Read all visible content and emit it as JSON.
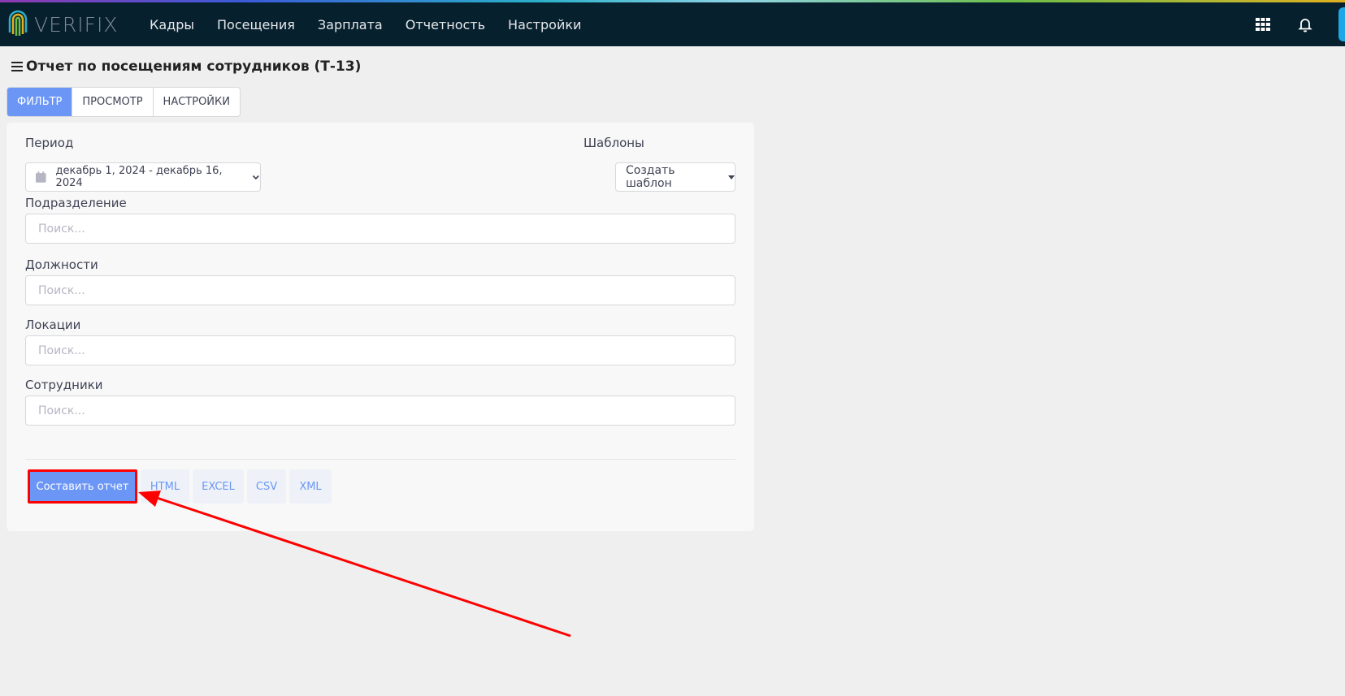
{
  "app": {
    "logo_text": "VERIFIX"
  },
  "nav": {
    "items": [
      "Кадры",
      "Посещения",
      "Зарплата",
      "Отчетность",
      "Настройки"
    ]
  },
  "page": {
    "title": "Отчет по посещениям сотрудников (Т-13)"
  },
  "tabs": [
    "ФИЛЬТР",
    "ПРОСМОТР",
    "НАСТРОЙКИ"
  ],
  "filter": {
    "period_label": "Период",
    "period_value": "декабрь 1, 2024 - декабрь 16, 2024",
    "templates_label": "Шаблоны",
    "templates_button": "Создать шаблон",
    "division_label": "Подразделение",
    "positions_label": "Должности",
    "locations_label": "Локации",
    "employees_label": "Сотрудники",
    "search_placeholder": "Поиск..."
  },
  "actions": {
    "run_label": "Составить отчет",
    "formats": [
      "HTML",
      "EXCEL",
      "CSV",
      "XML"
    ]
  },
  "colors": {
    "accent": "#6b96f6",
    "navbar": "#07202e",
    "highlight": "#ff0000"
  }
}
